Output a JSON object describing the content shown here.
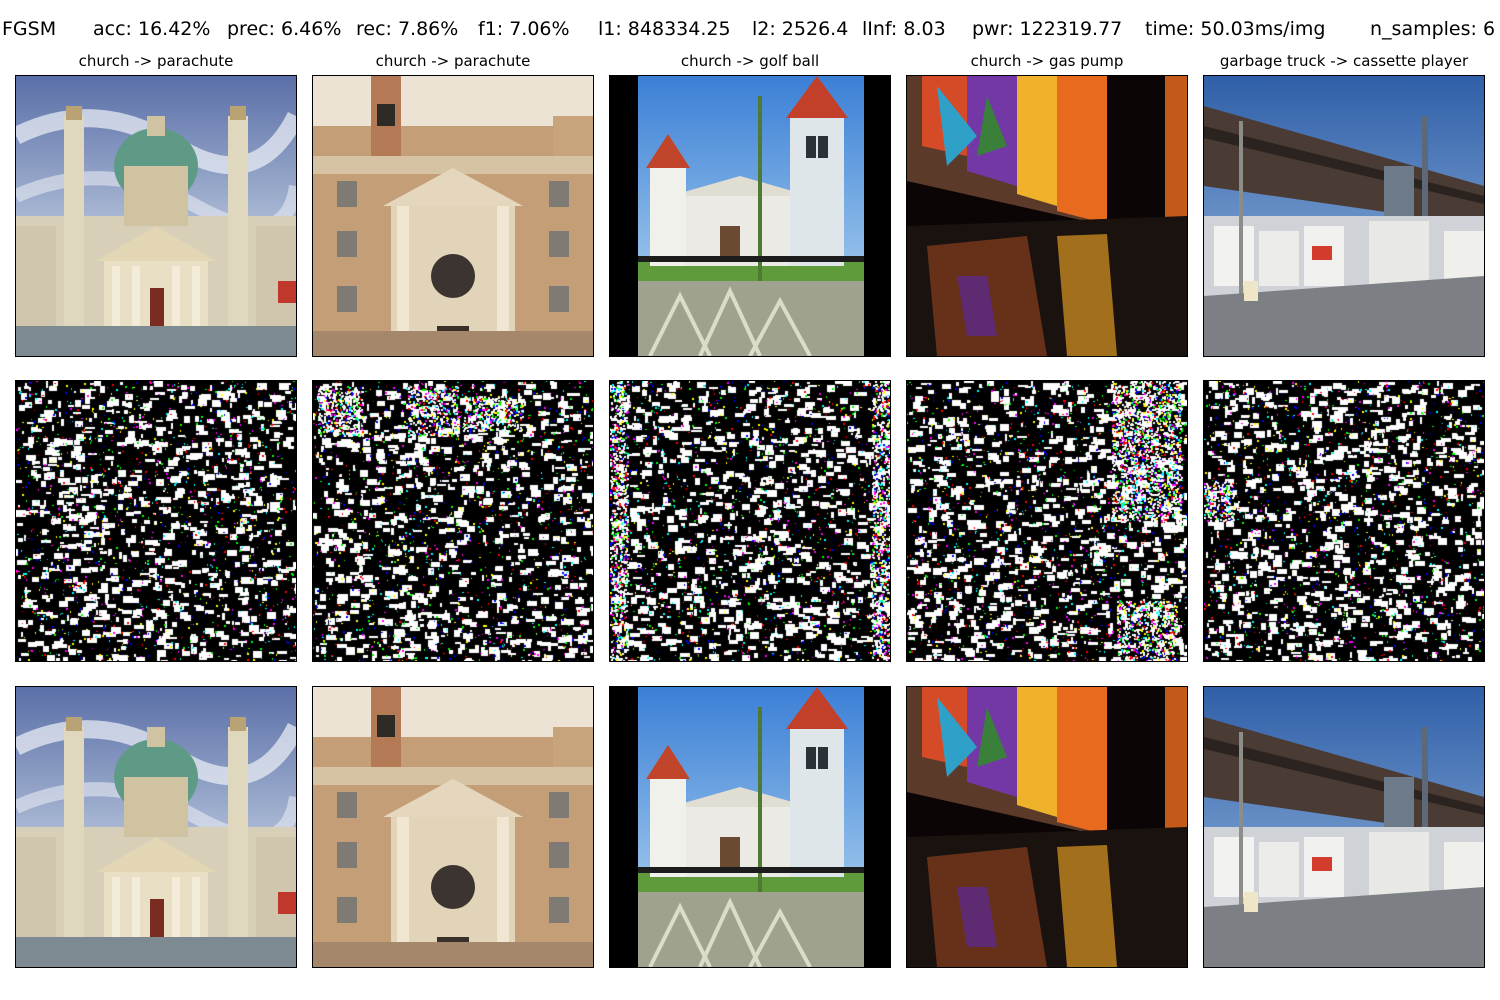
{
  "header": {
    "method": "FGSM",
    "acc": "acc: 16.42%",
    "prec": "prec: 6.46%",
    "rec": "rec: 7.86%",
    "f1": "f1: 7.06%",
    "l1": "l1: 848334.25",
    "l2": "l2: 2526.4",
    "linf": "lInf: 8.03",
    "pwr": "pwr: 122319.77",
    "time": "time: 50.03ms/img",
    "n_samples": "n_samples: 6"
  },
  "columns": [
    {
      "title": "church -> parachute",
      "scene": "baroque-church-dome"
    },
    {
      "title": "church -> parachute",
      "scene": "church-facade"
    },
    {
      "title": "church -> golf ball",
      "scene": "white-church-towers"
    },
    {
      "title": "church -> gas pump",
      "scene": "stained-glass-interior"
    },
    {
      "title": "garbage truck -> cassette player",
      "scene": "garbage-trucks-street"
    }
  ],
  "rows": [
    "original",
    "perturbation",
    "adversarial"
  ]
}
